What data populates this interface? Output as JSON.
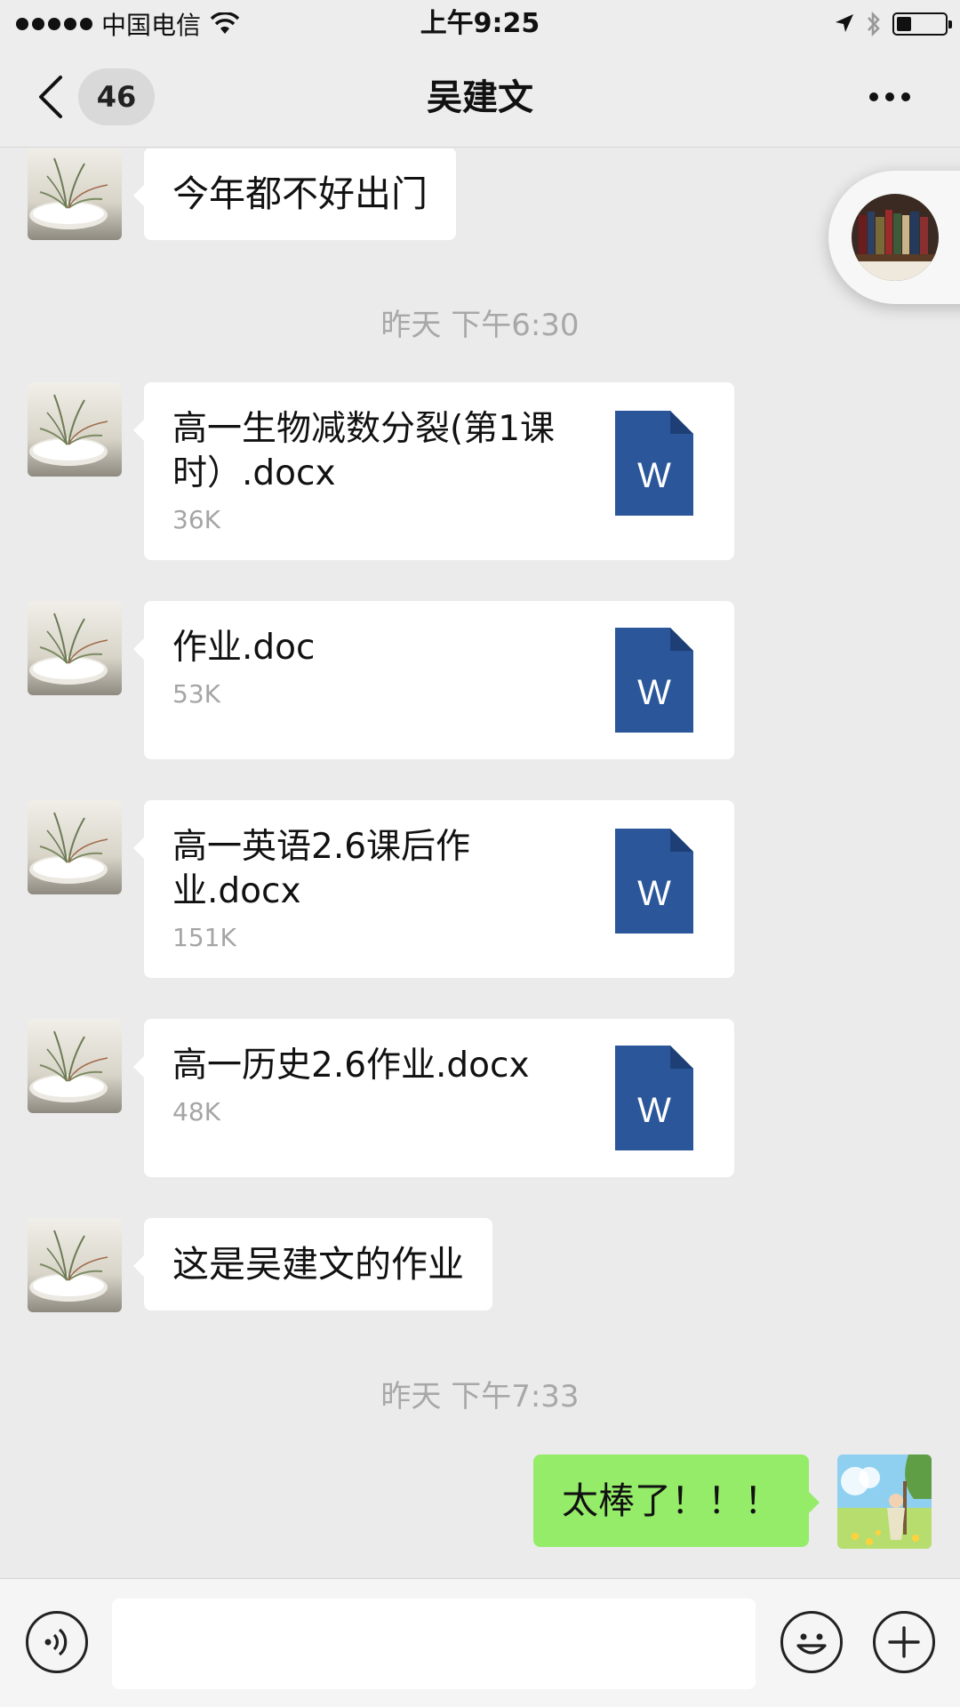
{
  "status_bar": {
    "carrier": "中国电信",
    "time": "上午9:25",
    "battery_level": 0.3
  },
  "nav": {
    "unread_count": "46",
    "title": "吴建文",
    "more_icon": "more-dots-icon",
    "back_icon": "chevron-left-icon"
  },
  "messages": [
    {
      "type": "text",
      "from": "contact",
      "text": "今年都不好出门"
    },
    {
      "type": "time",
      "text": "昨天 下午6:30"
    },
    {
      "type": "file",
      "from": "contact",
      "name": "高一生物减数分裂(第1课时）.docx",
      "size": "36K",
      "icon": "word-file-icon"
    },
    {
      "type": "file",
      "from": "contact",
      "name": "作业.doc",
      "size": "53K",
      "icon": "word-file-icon"
    },
    {
      "type": "file",
      "from": "contact",
      "name": "高一英语2.6课后作业.docx",
      "size": "151K",
      "icon": "word-file-icon"
    },
    {
      "type": "file",
      "from": "contact",
      "name": "高一历史2.6作业.docx",
      "size": "48K",
      "icon": "word-file-icon"
    },
    {
      "type": "text",
      "from": "contact",
      "text": "这是吴建文的作业"
    },
    {
      "type": "time",
      "text": "昨天 下午7:33"
    },
    {
      "type": "text",
      "from": "me",
      "text": "太棒了！！！"
    }
  ],
  "file_icon_letter": "W",
  "input_bar": {
    "voice_icon": "voice-icon",
    "emoji_icon": "emoji-icon",
    "plus_icon": "plus-icon"
  },
  "colors": {
    "background": "#ebebeb",
    "my_bubble": "#95ec69",
    "word_blue": "#2b579a"
  }
}
